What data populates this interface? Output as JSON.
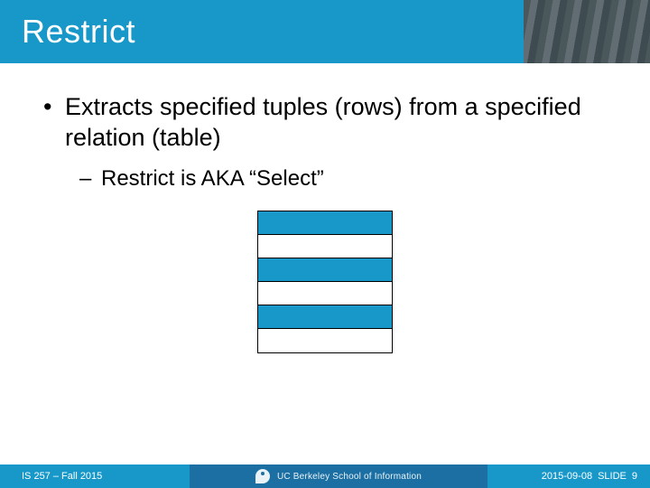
{
  "title": "Restrict",
  "bullets": {
    "l1": "Extracts specified tuples (rows) from a specified relation (table)",
    "l2": "Restrict is AKA “Select”"
  },
  "table_rows": [
    {
      "selected": true
    },
    {
      "selected": false
    },
    {
      "selected": true
    },
    {
      "selected": false
    },
    {
      "selected": true
    },
    {
      "selected": false
    }
  ],
  "footer": {
    "course": "IS 257 – Fall 2015",
    "school": "UC Berkeley School of Information",
    "date": "2015-09-08",
    "slide_label": "SLIDE",
    "slide_no": "9"
  }
}
